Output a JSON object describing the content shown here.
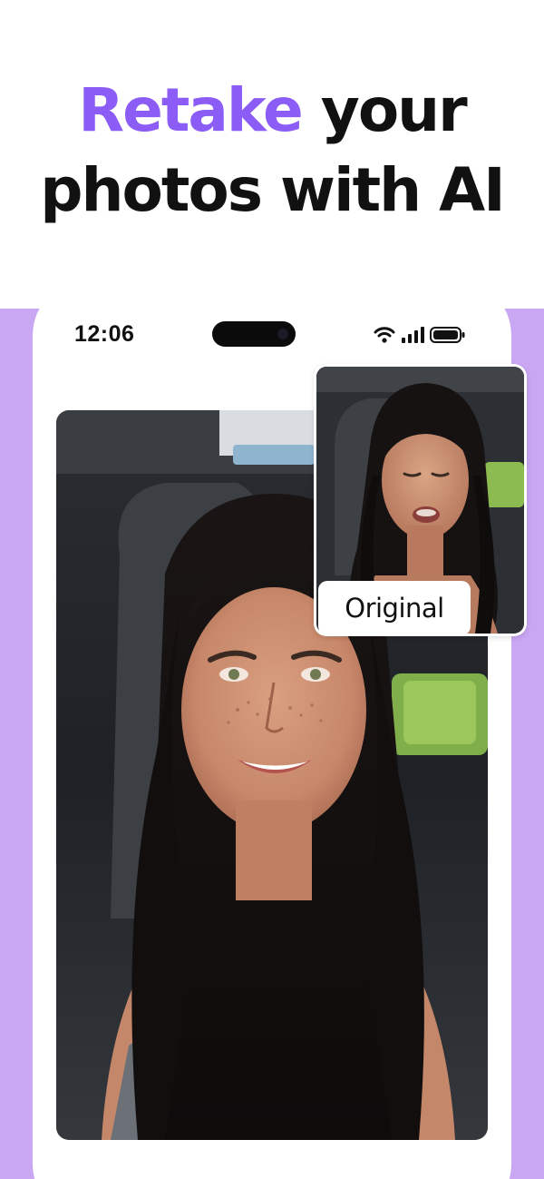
{
  "headline": {
    "accent_word": "Retake",
    "rest_line1": " your",
    "line2": "photos with AI"
  },
  "phone": {
    "status_bar": {
      "time": "12:06",
      "icons": [
        "wifi-icon",
        "cellular-signal-icon",
        "battery-icon"
      ]
    },
    "main_photo": {
      "subject": "retaken-selfie"
    },
    "comparison_thumbnail": {
      "label": "Original"
    }
  },
  "colors": {
    "accent": "#8b5cf6",
    "background_band": "#c9a7f3",
    "headline_text": "#111111"
  }
}
